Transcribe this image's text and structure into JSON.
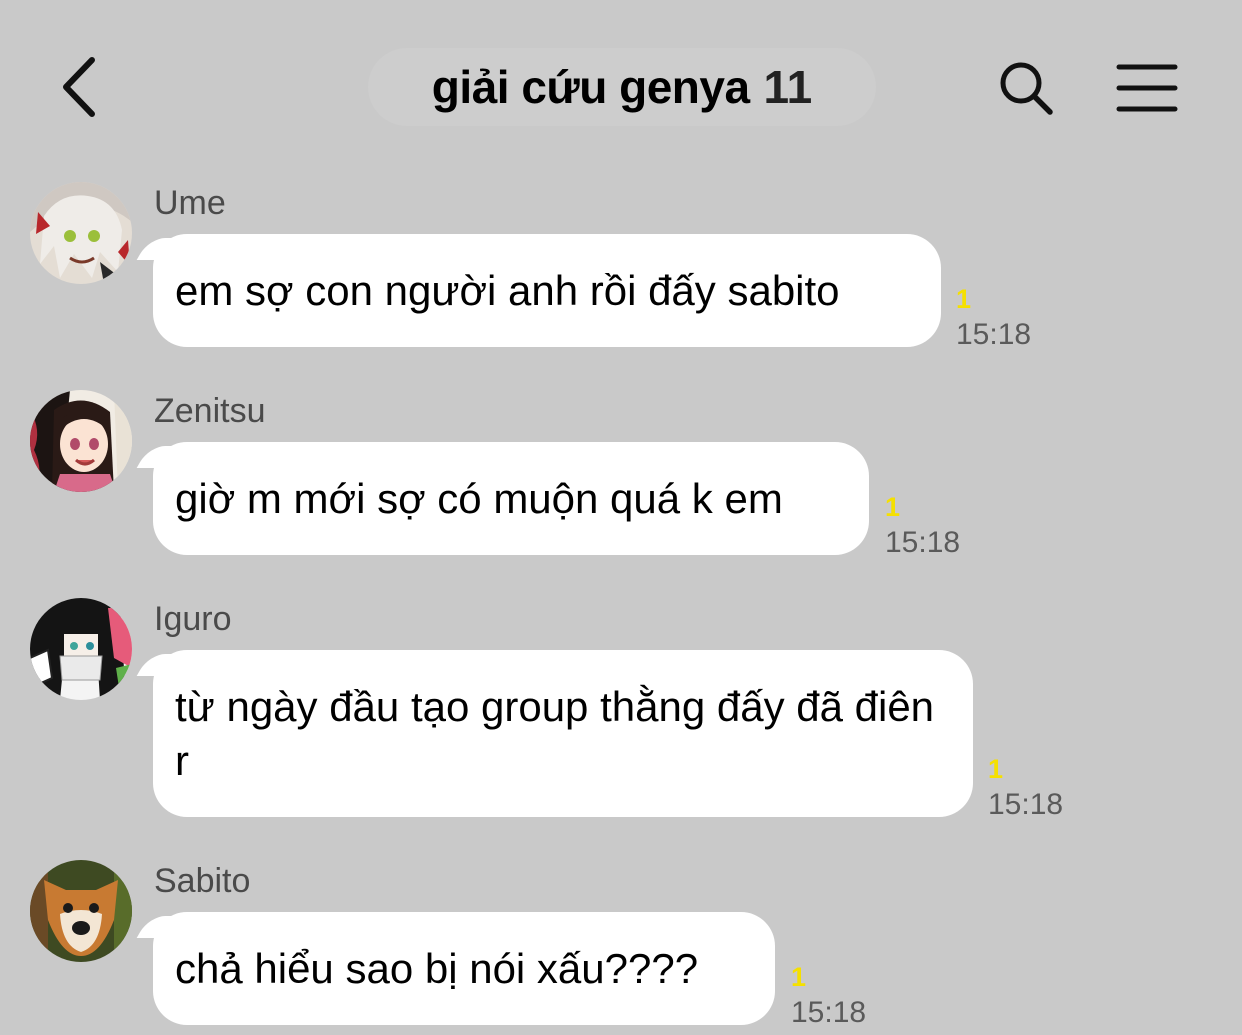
{
  "header": {
    "back_icon": "chevron-left-icon",
    "title": "giải cứu genya",
    "member_count": "11",
    "search_icon": "search-icon",
    "menu_icon": "hamburger-menu-icon"
  },
  "messages": [
    {
      "sender": "Ume",
      "text": "em sợ con người anh rồi đấy sabito",
      "unread": "1",
      "time": "15:18"
    },
    {
      "sender": "Zenitsu",
      "text": "giờ m mới sợ có muộn quá k em",
      "unread": "1",
      "time": "15:18"
    },
    {
      "sender": "Iguro",
      "text": "từ ngày đầu tạo group thằng đấy đã điên r",
      "unread": "1",
      "time": "15:18"
    },
    {
      "sender": "Sabito",
      "text": "chả hiểu sao bị nói xấu????",
      "unread": "1",
      "time": "15:18"
    }
  ],
  "colors": {
    "background": "#c9c9c9",
    "bubble": "#ffffff",
    "unread": "#f5e000"
  }
}
